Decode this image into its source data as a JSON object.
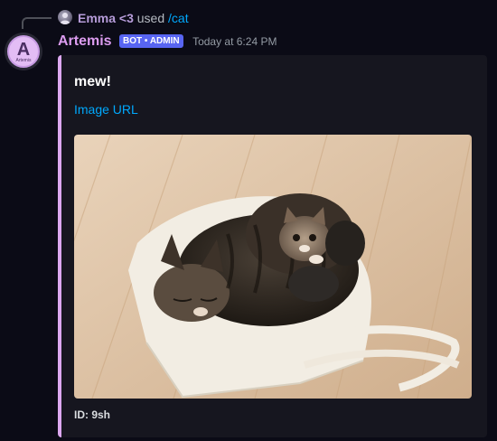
{
  "reply": {
    "username": "Emma <3",
    "used_text": "used",
    "command": "/cat"
  },
  "message": {
    "author": "Artemis",
    "avatar_letter": "A",
    "avatar_subtext": "Artemis",
    "tag": "BOT • ADMIN",
    "timestamp": "Today at 6:24 PM",
    "accent_color": "#dca8f0"
  },
  "embed": {
    "title": "mew!",
    "link_text": "Image URL",
    "image_alt": "Adult tabby cat curled up on a canvas tote bag with a tabby kitten on a wooden floor",
    "footer": "ID: 9sh"
  }
}
